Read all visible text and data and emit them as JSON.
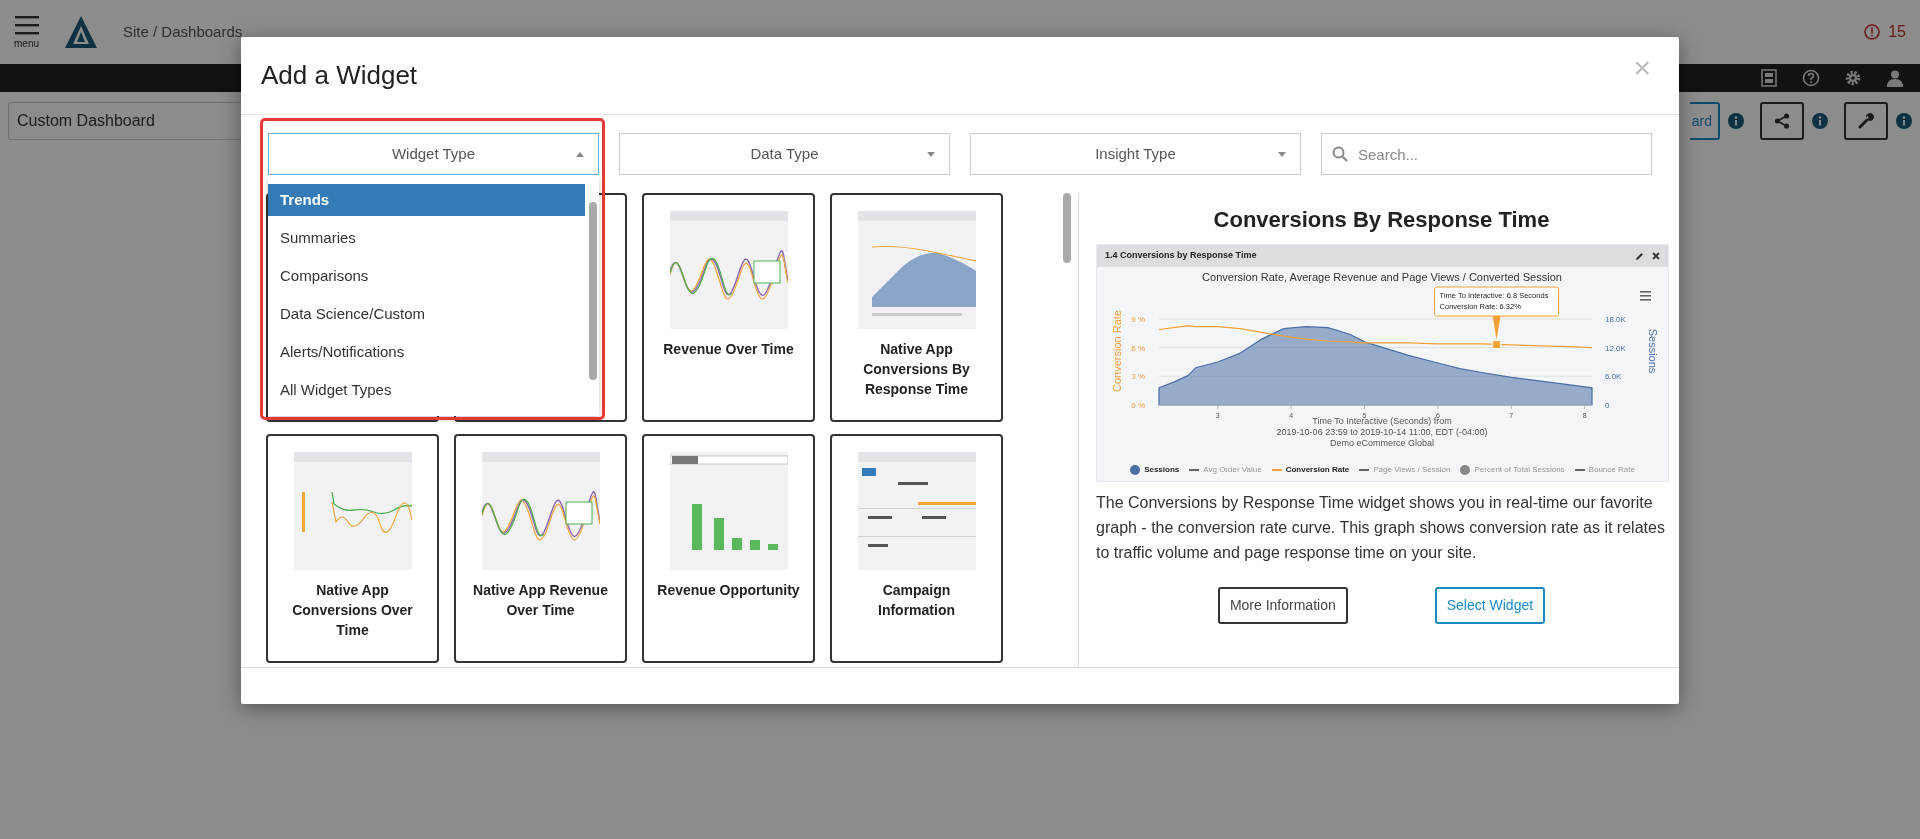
{
  "app": {
    "menu_label": "menu",
    "breadcrumb": "Site / Dashboards",
    "alert_count": "15",
    "dashboard_name": "Custom Dashboard",
    "partial_button": "ard"
  },
  "modal": {
    "title": "Add a Widget",
    "close": "×",
    "filters": [
      {
        "kind": "select",
        "label": "Widget Type",
        "expanded": true,
        "highlighted": true,
        "options": [
          {
            "label": "Trends",
            "selected": true
          },
          {
            "label": "Summaries",
            "selected": false
          },
          {
            "label": "Comparisons",
            "selected": false
          },
          {
            "label": "Data Science/Custom",
            "selected": false
          },
          {
            "label": "Alerts/Notifications",
            "selected": false
          },
          {
            "label": "All Widget Types",
            "selected": false
          }
        ]
      },
      {
        "kind": "select",
        "label": "Data Type",
        "expanded": false,
        "highlighted": false
      },
      {
        "kind": "select",
        "label": "Insight Type",
        "expanded": false,
        "highlighted": false
      },
      {
        "kind": "search",
        "placeholder": "Search..."
      }
    ],
    "cards": [
      {
        "kind": "covered"
      },
      {
        "kind": "covered"
      },
      {
        "kind": "multi-line",
        "title": "Revenue Over Time"
      },
      {
        "kind": "area",
        "title": "Native App Conversions By Response Time"
      },
      {
        "kind": "dual-line",
        "title": "Native App Conversions Over Time"
      },
      {
        "kind": "multi-line",
        "title": "Native App Revenue Over Time"
      },
      {
        "kind": "bars",
        "title": "Revenue Opportunity"
      },
      {
        "kind": "stats",
        "title": "Campaign Information"
      }
    ],
    "detail": {
      "title": "Conversions By Response Time",
      "preview": {
        "header": "1.4 Conversions by Response Time",
        "chart_data": {
          "type": "area",
          "title": "Conversion Rate, Average Revenue and Page Views / Converted Session",
          "xlabel": "Time To Interactive (Seconds) from",
          "ylabel": "Conversion Rate",
          "y2label": "Sessions",
          "x": [
            2.2,
            2.4,
            2.6,
            2.7,
            3.0,
            3.3,
            3.6,
            3.9,
            4.2,
            4.5,
            4.8,
            5.0,
            5.3,
            5.6,
            6.0,
            6.3,
            6.6,
            7.0,
            7.4,
            7.8,
            8.1
          ],
          "series": [
            {
              "name": "Sessions",
              "color": "#4a6fa5",
              "type": "area",
              "axis": "y2",
              "values": [
                3600,
                4800,
                6200,
                7800,
                9000,
                10800,
                13800,
                16000,
                16400,
                16200,
                14800,
                13200,
                11800,
                10400,
                8800,
                7600,
                6800,
                5800,
                5000,
                4200,
                3600
              ]
            },
            {
              "name": "Conversion Rate",
              "color": "#f7a035",
              "type": "line",
              "values": [
                7.9,
                8.1,
                8.3,
                8.2,
                8.2,
                8.0,
                7.6,
                7.2,
                6.9,
                6.7,
                6.6,
                6.5,
                6.5,
                6.5,
                6.4,
                6.4,
                6.4,
                6.3,
                6.2,
                6.1,
                6.0
              ]
            }
          ],
          "xlim": [
            2.2,
            8.1
          ],
          "ylim": [
            0,
            9
          ],
          "y2lim": [
            0,
            18000
          ],
          "xticks": [
            3,
            4,
            5,
            6,
            7,
            8
          ],
          "yticks": [
            {
              "value": 0,
              "label": "0 %"
            },
            {
              "value": 3,
              "label": "3 %"
            },
            {
              "value": 6,
              "label": "6 %"
            },
            {
              "value": 9,
              "label": "9 %"
            }
          ],
          "y2ticks": [
            {
              "value": 0,
              "label": "0"
            },
            {
              "value": 6000,
              "label": "6.0K"
            },
            {
              "value": 12000,
              "label": "12.0K"
            },
            {
              "value": 18000,
              "label": "18.0K"
            }
          ],
          "annotations": [
            {
              "x": 6.8,
              "y": 6.32,
              "text": "Time To Interactive: 6.8 Seconds\nConversion Rate: 6.32%"
            }
          ]
        },
        "caption_lines": [
          "2019-10-06 23:59 to 2019-10-14 11:00, EDT (-04:00)",
          "Demo eCommerce Global"
        ],
        "legend": [
          {
            "kind": "series",
            "active": true
          },
          {
            "kind": "line",
            "label": "Avg Order Value",
            "color": "#666666",
            "active": false
          },
          {
            "kind": "series",
            "active": true
          },
          {
            "kind": "line",
            "label": "Page Views / Session",
            "color": "#666666",
            "active": false
          },
          {
            "kind": "dot",
            "label": "Percent of Total Sessions",
            "color": "#888888",
            "active": false
          },
          {
            "kind": "line",
            "label": "Bounce Rate",
            "color": "#666666",
            "active": false
          }
        ]
      },
      "description": "The Conversions by Response Time widget shows you in real-time our favorite graph - the conversion rate curve. This graph shows conversion rate as it relates to traffic volume and page response time on your site.",
      "buttons": [
        {
          "label": "More Information",
          "kind": "secondary"
        },
        {
          "label": "Select Widget",
          "kind": "primary"
        }
      ]
    }
  }
}
